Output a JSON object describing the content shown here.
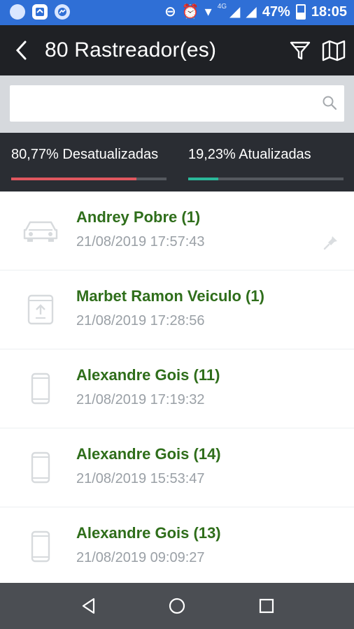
{
  "status_bar": {
    "network": "4G",
    "battery": "47%",
    "time": "18:05"
  },
  "header": {
    "title": "80 Rastreador(es)"
  },
  "search": {
    "placeholder": "",
    "value": ""
  },
  "stats": {
    "outdated_label": "80,77% Desatualizadas",
    "outdated_percent": 80.77,
    "outdated_color": "#e0575f",
    "updated_label": "19,23% Atualizadas",
    "updated_percent": 19.23,
    "updated_color": "#2bb89a"
  },
  "trackers": [
    {
      "name": "Andrey Pobre (1)",
      "timestamp": "21/08/2019 17:57:43",
      "icon": "car-icon",
      "pinned": true
    },
    {
      "name": "Marbet Ramon Veiculo (1)",
      "timestamp": "21/08/2019 17:28:56",
      "icon": "tablet-upload-icon",
      "pinned": false
    },
    {
      "name": "Alexandre Gois (11)",
      "timestamp": "21/08/2019 17:19:32",
      "icon": "phone-icon",
      "pinned": false
    },
    {
      "name": "Alexandre Gois (14)",
      "timestamp": "21/08/2019 15:53:47",
      "icon": "phone-icon",
      "pinned": false
    },
    {
      "name": "Alexandre Gois (13)",
      "timestamp": "21/08/2019 09:09:27",
      "icon": "phone-icon",
      "pinned": false
    }
  ],
  "colors": {
    "name_text": "#2f6e1b",
    "timestamp_text": "#9aa0a6",
    "appbar": "#1f2125",
    "statusbar": "#2f6fd6"
  }
}
